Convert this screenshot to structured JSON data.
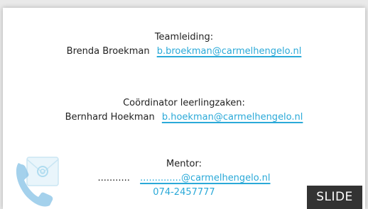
{
  "team": {
    "heading": "Teamleiding:",
    "name": "Brenda Broekman",
    "email": "b.broekman@carmelhengelo.nl"
  },
  "coordinator": {
    "heading": "Coördinator leerlingzaken:",
    "name": "Bernhard Hoekman",
    "email": "b.hoekman@carmelhengelo.nl"
  },
  "mentor": {
    "heading": "Mentor:",
    "name": "...........",
    "email": "..............@carmelhengelo.nl",
    "phone": "074-2457777"
  },
  "badge": {
    "label": "SLIDE"
  },
  "icons": {
    "illustration": "phone-envelope-icon"
  },
  "colors": {
    "link": "#2aa9d8",
    "text": "#222222",
    "badge_bg": "#333333"
  }
}
